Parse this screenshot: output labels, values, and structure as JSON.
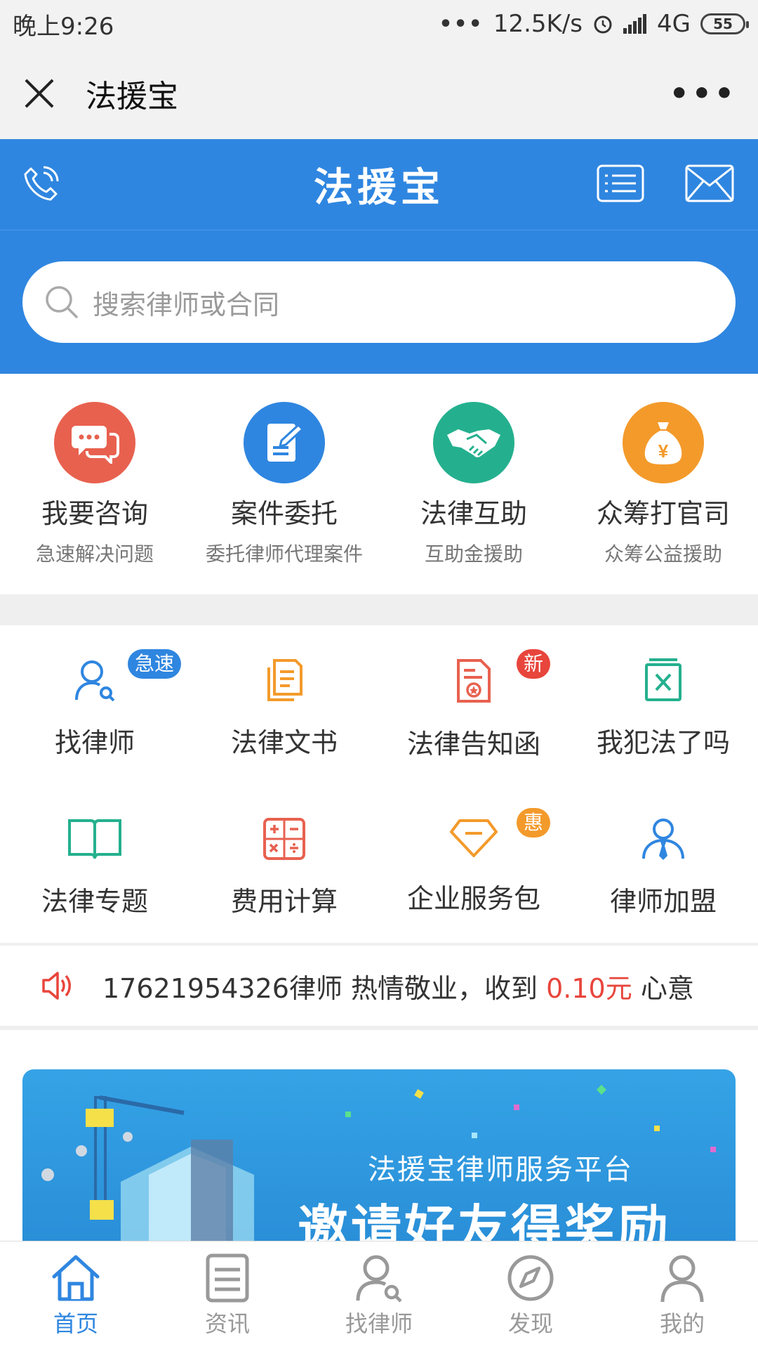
{
  "status": {
    "time": "晚上9:26",
    "speed": "12.5K/s",
    "network": "4G",
    "battery": "55"
  },
  "wechat": {
    "title": "法援宝"
  },
  "header": {
    "title": "法援宝"
  },
  "search": {
    "placeholder": "搜索律师或合同"
  },
  "main_items": [
    {
      "name": "我要咨询",
      "sub": "急速解决问题",
      "color": "#e8614f"
    },
    {
      "name": "案件委托",
      "sub": "委托律师代理案件",
      "color": "#2f86e0"
    },
    {
      "name": "法律互助",
      "sub": "互助金援助",
      "color": "#24b08e"
    },
    {
      "name": "众筹打官司",
      "sub": "众筹公益援助",
      "color": "#f39a2b"
    }
  ],
  "sub_items": [
    {
      "name": "找律师",
      "badge": "急速"
    },
    {
      "name": "法律文书"
    },
    {
      "name": "法律告知函",
      "badge": "新"
    },
    {
      "name": "我犯法了吗"
    },
    {
      "name": "法律专题"
    },
    {
      "name": "费用计算"
    },
    {
      "name": "企业服务包",
      "badge": "惠"
    },
    {
      "name": "律师加盟"
    }
  ],
  "notice": {
    "prefix": "17621954326律师 热情敬业，收到 ",
    "amount": "0.10元",
    "suffix": " 心意"
  },
  "banner": {
    "line1": "法援宝律师服务平台",
    "line2": "邀请好友得奖励"
  },
  "tabs": [
    {
      "label": "首页",
      "icon": "home-icon",
      "active": true
    },
    {
      "label": "资讯",
      "icon": "news-icon"
    },
    {
      "label": "找律师",
      "icon": "find-lawyer-icon"
    },
    {
      "label": "发现",
      "icon": "compass-icon"
    },
    {
      "label": "我的",
      "icon": "profile-icon"
    }
  ],
  "colors": {
    "brand_blue": "#2f86e0",
    "accent_red": "#e8453c",
    "badge_orange": "#f39a2b"
  }
}
